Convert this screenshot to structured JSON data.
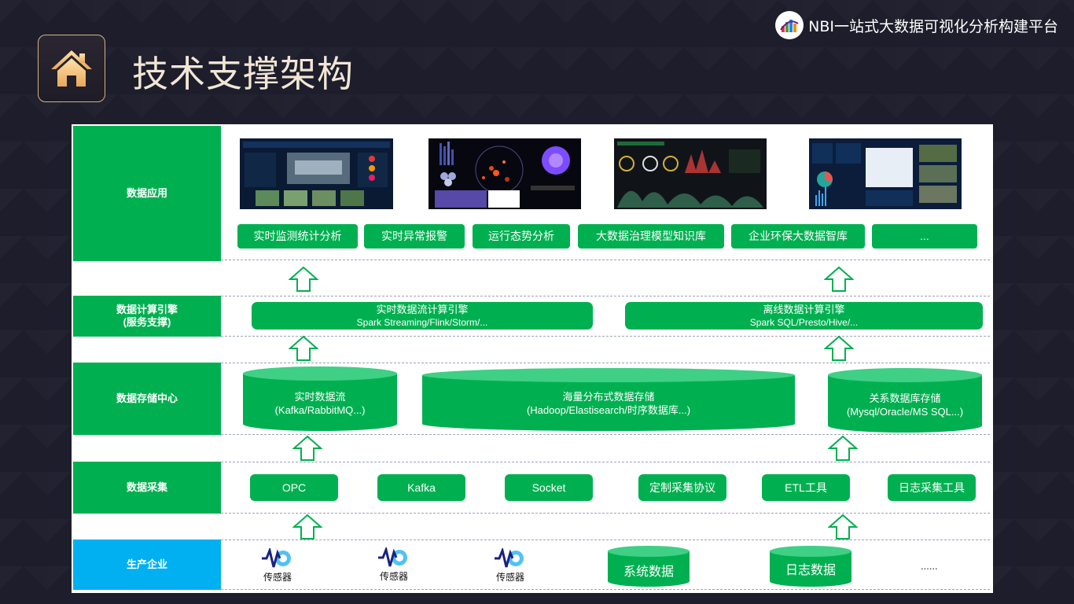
{
  "header": {
    "title": "技术支撑架构",
    "brand": "NBI一站式大数据可视化分析构建平台"
  },
  "layers": {
    "app": {
      "label": "数据应用",
      "buttons": [
        "实时监测统计分析",
        "实时异常报警",
        "运行态势分析",
        "大数据治理模型知识库",
        "企业环保大数据智库",
        "..."
      ]
    },
    "compute": {
      "label": "数据计算引擎\n(服务支撑)",
      "engines": [
        {
          "name": "实时数据流计算引擎",
          "tech": "Spark Streaming/Flink/Storm/..."
        },
        {
          "name": "离线数据计算引擎",
          "tech": "Spark SQL/Presto/Hive/..."
        }
      ]
    },
    "storage": {
      "label": "数据存储中心",
      "items": [
        {
          "name": "实时数据流",
          "tech": "(Kafka/RabbitMQ...)"
        },
        {
          "name": "海量分布式数据存储",
          "tech": "(Hadoop/Elastisearch/时序数据库...)"
        },
        {
          "name": "关系数据库存储",
          "tech": "(Mysql/Oracle/MS SQL...)"
        }
      ]
    },
    "collect": {
      "label": "数据采集",
      "buttons": [
        "OPC",
        "Kafka",
        "Socket",
        "定制采集协议",
        "ETL工具",
        "日志采集工具"
      ]
    },
    "source": {
      "label": "生产企业",
      "sensors": [
        "传感器",
        "传感器",
        "传感器"
      ],
      "stores": [
        "系统数据",
        "日志数据"
      ],
      "more": "......"
    }
  },
  "colors": {
    "green": "#00b050",
    "blue": "#00b0f0",
    "background": "#1d1d2b",
    "title": "#f1e6d6"
  }
}
